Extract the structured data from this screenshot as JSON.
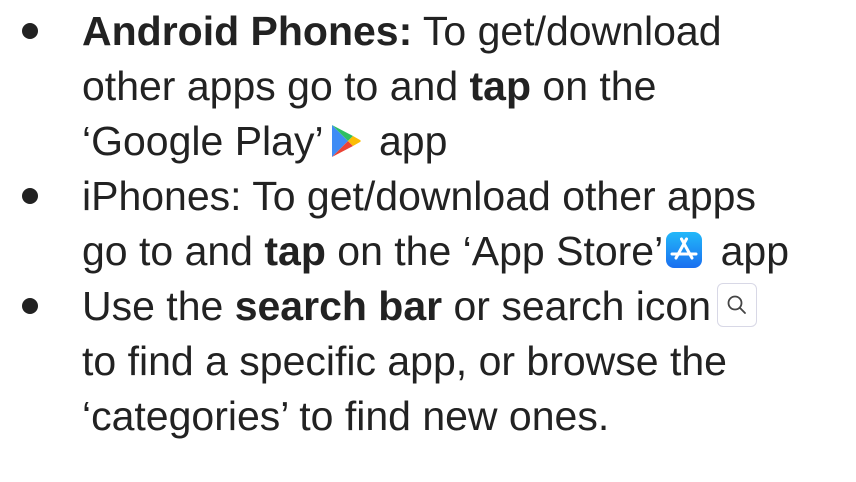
{
  "items": [
    {
      "lines": [
        {
          "bold_1": "Android Phones:",
          "text_1": " To get/download"
        },
        {
          "text_1": "other apps go to and ",
          "bold_1": "tap",
          "text_2": " on  the"
        },
        {
          "text_1": "‘Google Play’",
          "text_2": " app"
        }
      ],
      "icon": "google-play-icon"
    },
    {
      "lines": [
        {
          "text_1": "iPhones: To get/download other apps"
        },
        {
          "text_1": "go to and ",
          "bold_1": "tap",
          "text_2": " on the ‘App Store’",
          "text_3": " app"
        }
      ],
      "icon": "app-store-icon"
    },
    {
      "lines": [
        {
          "text_1": "Use the ",
          "bold_1": "search bar",
          "text_2": " or search icon"
        },
        {
          "text_1": "to find a specific app, or browse the"
        },
        {
          "text_1": "‘categories’ to find new ones."
        }
      ],
      "icon": "search-icon"
    }
  ],
  "colors": {
    "text": "#222222",
    "play_blue": "#3f8cf5",
    "play_green": "#2fbf63",
    "play_yellow": "#fbbc04",
    "play_red": "#ea4335",
    "appstore_blue": "#1d8fee"
  }
}
